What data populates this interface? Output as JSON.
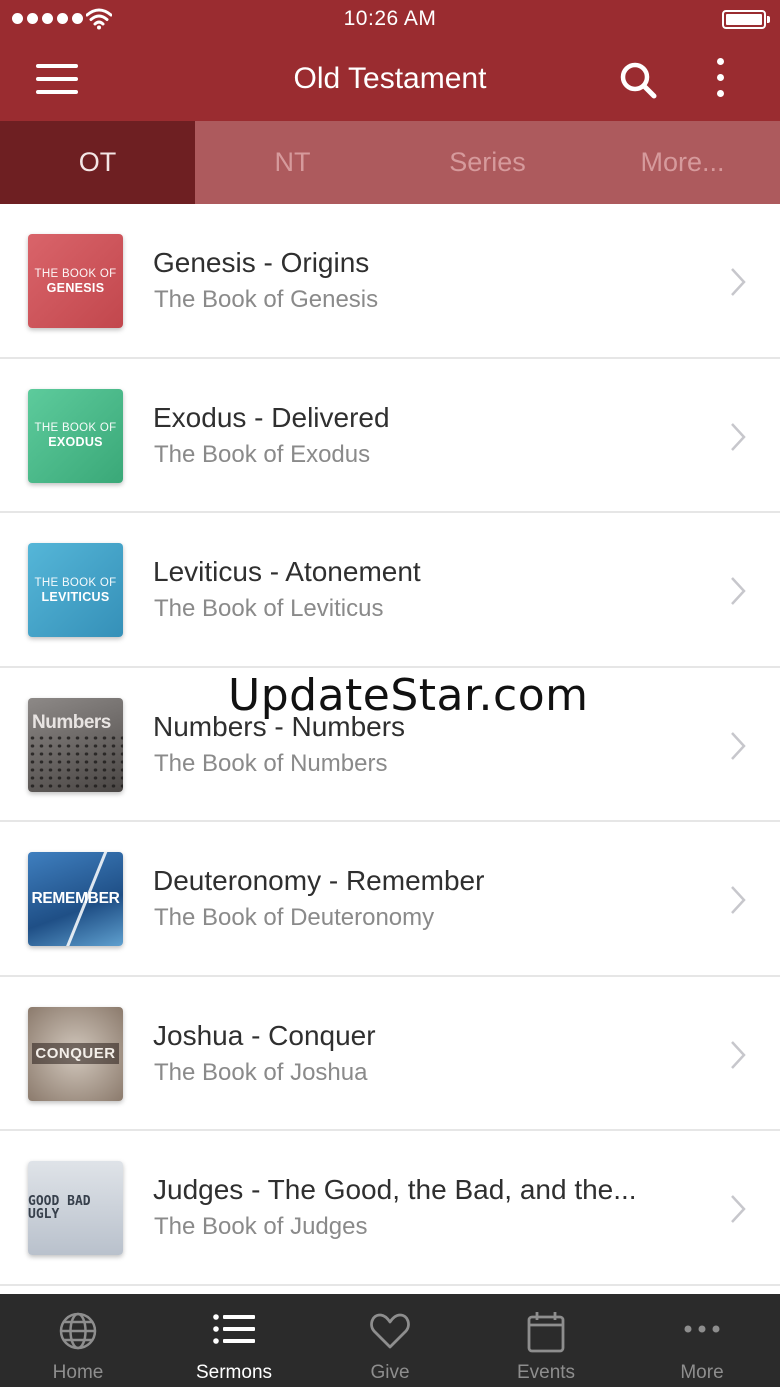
{
  "status": {
    "time": "10:26 AM"
  },
  "header": {
    "title": "Old Testament"
  },
  "tabs": [
    {
      "label": "OT"
    },
    {
      "label": "NT"
    },
    {
      "label": "Series"
    },
    {
      "label": "More..."
    }
  ],
  "sermons": [
    {
      "title": "Genesis - Origins",
      "subtitle": "The Book of Genesis",
      "art_small": "THE BOOK OF",
      "art_big": "GENESIS"
    },
    {
      "title": "Exodus - Delivered",
      "subtitle": "The Book of Exodus",
      "art_small": "THE BOOK OF",
      "art_big": "EXODUS"
    },
    {
      "title": "Leviticus - Atonement",
      "subtitle": "The Book of Leviticus",
      "art_small": "THE BOOK OF",
      "art_big": "LEVITICUS"
    },
    {
      "title": "Numbers - Numbers",
      "subtitle": "The Book of Numbers",
      "art_big": "Numbers"
    },
    {
      "title": "Deuteronomy - Remember",
      "subtitle": "The Book of Deuteronomy",
      "art_big": "REMEMBER"
    },
    {
      "title": "Joshua - Conquer",
      "subtitle": "The Book of Joshua",
      "art_big": "CONQUER"
    },
    {
      "title": "Judges - The Good, the Bad, and the...",
      "subtitle": "The Book of Judges",
      "art_big": "GOOD BAD UGLY"
    }
  ],
  "watermark": "UpdateStar.com",
  "bottom_nav": [
    {
      "label": "Home",
      "icon": "globe-icon"
    },
    {
      "label": "Sermons",
      "icon": "list-icon"
    },
    {
      "label": "Give",
      "icon": "heart-icon"
    },
    {
      "label": "Events",
      "icon": "calendar-icon"
    },
    {
      "label": "More",
      "icon": "ellipsis-icon"
    }
  ],
  "colors": {
    "brand": "#9a2c30",
    "tab_active": "#6e1f22",
    "tabbar_bg": "#2b2b2b"
  }
}
